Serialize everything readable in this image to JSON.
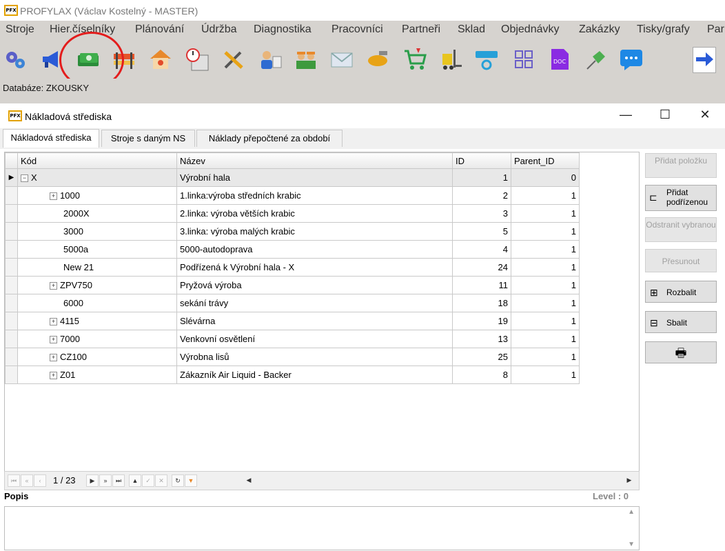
{
  "app": {
    "title": "PROFYLAX (Václav Kostelný - MASTER)",
    "logo": "PFX"
  },
  "menu": [
    "Stroje",
    "Hier.číselníky",
    "Plánování",
    "Údržba",
    "Diagnostika",
    "Pracovníci",
    "Partneři",
    "Sklad",
    "Objednávky",
    "Zakázky",
    "Tisky/grafy",
    "Par"
  ],
  "toolbar": [
    "gears-icon",
    "megaphone-icon",
    "money-icon",
    "barrier-icon",
    "house-icon",
    "calendar-clock-icon",
    "tools-icon",
    "person-card-icon",
    "workers-icon",
    "envelope-icon",
    "handshake-icon",
    "cart-icon",
    "forklift-icon",
    "device-refresh-icon",
    "grid-icon",
    "doc-icon",
    "pin-icon",
    "chat-icon",
    "arrow-right-icon"
  ],
  "database_label": "Databáze: ZKOUSKY",
  "window": {
    "title": "Nákladová střediska",
    "logo": "PFX"
  },
  "tabs": [
    "Nákladová střediska",
    "Stroje s daným NS",
    "Náklady přepočtené za období"
  ],
  "grid": {
    "columns": [
      "Kód",
      "Název",
      "ID",
      "Parent_ID"
    ],
    "rows": [
      {
        "toggle": "−",
        "kod": "X",
        "nazev": "Výrobní hala",
        "id": "1",
        "parent": "0"
      },
      {
        "toggle": "+",
        "kod": "1000",
        "nazev": "1.linka:výroba středních krabic",
        "id": "2",
        "parent": "1"
      },
      {
        "toggle": "",
        "kod": "2000X",
        "nazev": "2.linka: výroba větších krabic",
        "id": "3",
        "parent": "1"
      },
      {
        "toggle": "",
        "kod": "3000",
        "nazev": "3.linka: výroba malých krabic",
        "id": "5",
        "parent": "1"
      },
      {
        "toggle": "",
        "kod": "5000a",
        "nazev": "5000-autodoprava",
        "id": "4",
        "parent": "1"
      },
      {
        "toggle": "",
        "kod": "New 21",
        "nazev": "Podřízená k Výrobní hala - X",
        "id": "24",
        "parent": "1"
      },
      {
        "toggle": "+",
        "kod": "ZPV750",
        "nazev": "Pryžová výroba",
        "id": "11",
        "parent": "1"
      },
      {
        "toggle": "",
        "kod": "6000",
        "nazev": "sekání trávy",
        "id": "18",
        "parent": "1"
      },
      {
        "toggle": "+",
        "kod": "4115",
        "nazev": "Slévárna",
        "id": "19",
        "parent": "1"
      },
      {
        "toggle": "+",
        "kod": "7000",
        "nazev": "Venkovní osvětlení",
        "id": "13",
        "parent": "1"
      },
      {
        "toggle": "+",
        "kod": "CZ100",
        "nazev": "Výrobna lisů",
        "id": "25",
        "parent": "1"
      },
      {
        "toggle": "+",
        "kod": "Z01",
        "nazev": "Zákazník Air Liquid - Backer",
        "id": "8",
        "parent": "1"
      }
    ]
  },
  "nav": {
    "page": "1 / 23"
  },
  "side_buttons": {
    "add_item": "Přidat položku",
    "add_child": "Přidat podřízenou",
    "remove": "Odstranit vybranou",
    "move": "Přesunout",
    "expand": "Rozbalit",
    "collapse": "Sbalit"
  },
  "popis_label": "Popis",
  "level_label": "Level : 0",
  "colors": {
    "accent_circle": "#e31c1c",
    "toolbar_bg": "#d6d3cf"
  }
}
